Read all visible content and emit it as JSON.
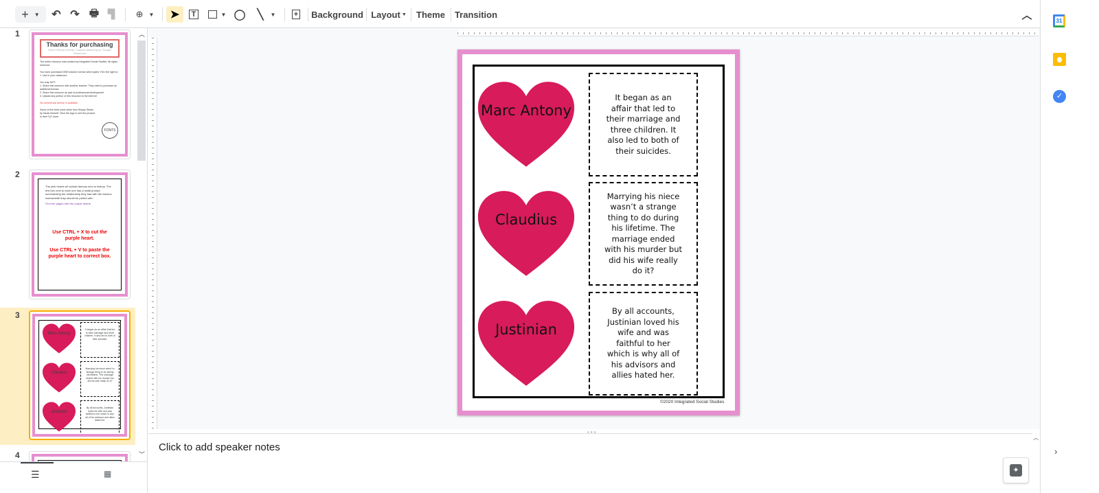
{
  "toolbar": {
    "background": "Background",
    "layout": "Layout",
    "theme": "Theme",
    "transition": "Transition"
  },
  "slides": [
    {
      "number": "1",
      "title": "Thanks for purchasing",
      "subtitle": "World History Activity: Couples Matching for Google Classroom",
      "lines": [
        "The entire resource was created by Integrated Social Studies. All rights reserved.",
        "You have purchased ONE teacher license which gives YOU the right to:",
        "1. Use in your classroom",
        "You may NOT:",
        "1. Share this resource with another teacher. They need to purchase an additional license",
        "2. Share this resource as part of professional development",
        "3. Upload any portion of this resource to the internet"
      ],
      "red_line": "No commercial license is available.",
      "fonts_note": "Some of the fonts used came from Simply Steam by Sarah Barnett. Click the logo to see the product in their TpT store.",
      "logo": "FONTS"
    },
    {
      "number": "2",
      "intro": "The pink hearts all contain famous men in history. The text box next to each one has a small prompt summarizing the relationship they had with the famous woman/wife they should be paired with.",
      "purple": "Find the pages with the purple hearts.",
      "red1": "Use CTRL + X to cut the purple heart.",
      "red2": "Use CTRL + V to paste the purple heart to correct box."
    },
    {
      "number": "3"
    },
    {
      "number": "4"
    }
  ],
  "current_slide": {
    "items": [
      {
        "name": "Marc Antony",
        "prompt": "It began as an affair that led to their marriage and three children. It also led to both of their suicides."
      },
      {
        "name": "Claudius",
        "prompt": "Marrying his niece wasn’t a strange thing to do during his lifetime. The marriage ended with his murder but did his wife really do it?"
      },
      {
        "name": "Justinian",
        "prompt": "By all accounts, Justinian loved his wife and was faithful to her which is why all of his advisors and allies hated her."
      }
    ],
    "copyright": "©2020 Integrated Social Studies"
  },
  "notes": {
    "placeholder": "Click to add speaker notes"
  },
  "sidepanel": {
    "calendar_day": "31"
  },
  "colors": {
    "heart": "#d81b5a",
    "border": "#e68fce",
    "selected": "#fdefc3"
  }
}
